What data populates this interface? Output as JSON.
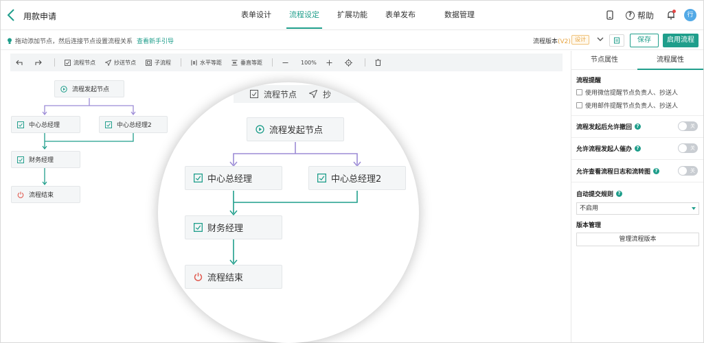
{
  "header": {
    "title": "用款申请",
    "tabs": [
      {
        "label": "表单设计"
      },
      {
        "label": "流程设定"
      },
      {
        "label": "扩展功能"
      },
      {
        "label": "表单发布"
      },
      {
        "label": "数据管理"
      }
    ],
    "active_tab": "流程设定",
    "help_label": "帮助",
    "avatar_text": "行"
  },
  "subbar": {
    "tip_text": "拖动添加节点，然后连接节点设置流程关系",
    "tip_link": "查看新手引导",
    "version_label": "流程版本",
    "version_value": "(V2)",
    "status_badge": "设计",
    "save_label": "保存",
    "enable_label": "启用流程"
  },
  "toolbar": {
    "flow_node": "流程节点",
    "cc_node": "抄送节点",
    "subprocess": "子流程",
    "h_equal": "水平等距",
    "v_equal": "垂直等距",
    "zoom": "100%"
  },
  "nodes": {
    "start": "流程发起节点",
    "center_mgr": "中心总经理",
    "center_mgr2": "中心总经理2",
    "finance_mgr": "财务经理",
    "end": "流程结束"
  },
  "lens": {
    "flow_node": "流程节点",
    "cc_partial": "抄"
  },
  "panel": {
    "tabs": [
      {
        "label": "节点属性"
      },
      {
        "label": "流程属性"
      }
    ],
    "reminder_title": "流程提醒",
    "wechat_reminder": "使用微信提醒节点负责人、抄送人",
    "email_reminder": "使用邮件提醒节点负责人、抄送人",
    "allow_withdraw": "流程发起后允许撤回",
    "allow_urge": "允许流程发起人催办",
    "allow_view_log": "允许查看流程日志和流转图",
    "toggle_off": "关",
    "auto_submit_title": "自动提交规则",
    "auto_submit_value": "不启用",
    "version_mgmt_title": "版本管理",
    "manage_versions_label": "管理流程版本"
  },
  "colors": {
    "accent": "#1f9e8b",
    "connector_purple": "#9b8ad6",
    "connector_green": "#1f9e8b",
    "end_icon": "#e05a4f"
  }
}
